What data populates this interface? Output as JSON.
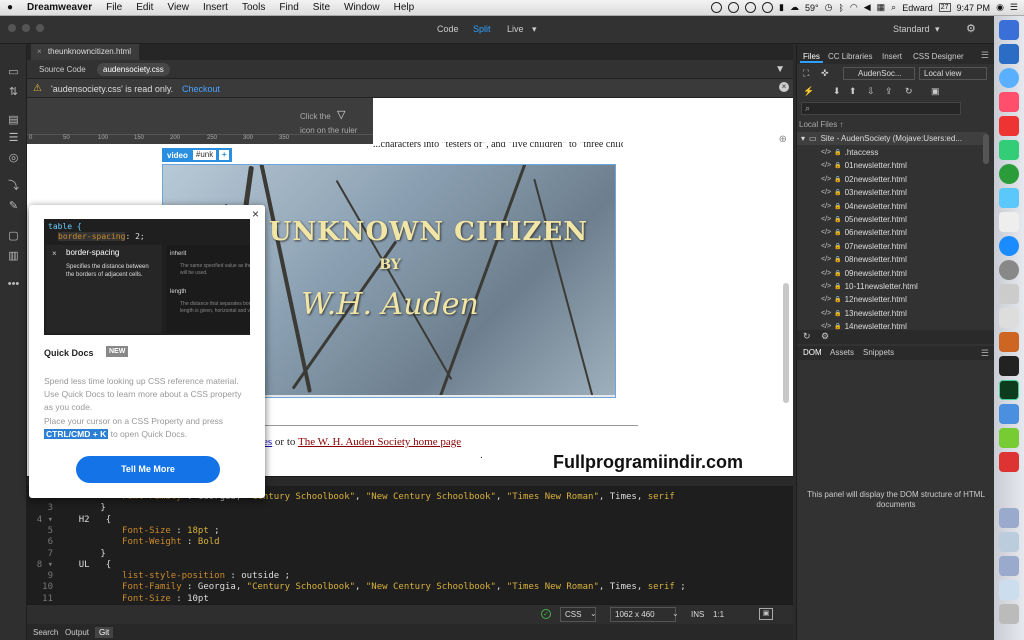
{
  "menubar": {
    "apple": "",
    "app": "Dreamweaver",
    "items": [
      "File",
      "Edit",
      "View",
      "Insert",
      "Tools",
      "Find",
      "Site",
      "Window",
      "Help"
    ],
    "temp": "59°",
    "user": "Edward",
    "date_badge": "27",
    "time": "9:47 PM"
  },
  "toolbar": {
    "modes": [
      "Code",
      "Split",
      "Live"
    ],
    "active_mode": "Split",
    "live_caret": "▾",
    "workspace": "Standard",
    "workspace_caret": "▾"
  },
  "doc": {
    "tab_title": "theunknowncitizen.html",
    "related_tabs": [
      "Source Code",
      "audensociety.css"
    ],
    "notice_prefix": "'audensociety.css' is read only.",
    "notice_link": "Checkout",
    "ruler_hint_line1": "Click the",
    "ruler_hint_line2": "icon on the ruler",
    "ruler_ticks": [
      "0",
      "50",
      "100",
      "150",
      "200",
      "250",
      "300",
      "350"
    ],
    "body_text_top": "...characters into \"testers of\", and \"live children\" to \"three children\".",
    "video_tag": "video",
    "video_id": "#unk",
    "video_plus": "+",
    "video_line1": "THE UNKNOWN CITIZEN",
    "video_line2": "BY",
    "video_line3": "W.H. Auden",
    "link_text_partial": "es",
    "link_or": "or to",
    "link_society": "The W. H. Auden Society home page",
    "dot": "."
  },
  "watermark": "Fullprogramiindir.com",
  "quickdocs": {
    "close": "×",
    "code_line1": "table {",
    "code_prop": "border-spacing",
    "code_val": ": 2;",
    "hint_title": "border-spacing",
    "hint_desc": "Specifies the distance between the borders of adjacent cells.",
    "hint_right_h1": "inherit",
    "hint_right_t1": "The same specified value as the element's parent will be used.",
    "hint_right_h2": "length",
    "hint_right_t2": "The distance that separates borders. If one length is given, horizontal and vertical",
    "title": "Quick Docs",
    "badge": "NEW",
    "para1": "Spend less time looking up CSS reference material. Use Quick Docs to learn more about a CSS property as you code.",
    "para2_a": "Place your cursor on a CSS Property and press",
    "kbd": "CTRL/CMD + K",
    "para2_b": "to open Quick Docs.",
    "button": "Tell Me More"
  },
  "code": {
    "lines": [
      {
        "n": "",
        "indent": "            ",
        "parts": [
          [
            "k",
            "Font-Family"
          ],
          [
            "t",
            " : Georgia, "
          ],
          [
            "s",
            "\"Century Schoolbook\""
          ],
          [
            "t",
            ", "
          ],
          [
            "s",
            "\"New Century Schoolbook\""
          ],
          [
            "t",
            ", "
          ],
          [
            "s",
            "\"Times New Roman\""
          ],
          [
            "t",
            ", Times, "
          ],
          [
            "s",
            "serif"
          ]
        ]
      },
      {
        "n": "3",
        "indent": "        ",
        "parts": [
          [
            "t",
            "}"
          ]
        ]
      },
      {
        "n": "4 ▾",
        "indent": "    ",
        "parts": [
          [
            "t",
            "H2   {"
          ]
        ]
      },
      {
        "n": "5",
        "indent": "            ",
        "parts": [
          [
            "k",
            "Font-Size"
          ],
          [
            "t",
            " : "
          ],
          [
            "s",
            "18pt"
          ],
          [
            "t",
            " ;"
          ]
        ]
      },
      {
        "n": "6",
        "indent": "            ",
        "parts": [
          [
            "k",
            "Font-Weight"
          ],
          [
            "t",
            " : "
          ],
          [
            "s",
            "Bold"
          ]
        ]
      },
      {
        "n": "7",
        "indent": "        ",
        "parts": [
          [
            "t",
            "}"
          ]
        ]
      },
      {
        "n": "8 ▾",
        "indent": "    ",
        "parts": [
          [
            "t",
            "UL   {"
          ]
        ]
      },
      {
        "n": "9",
        "indent": "            ",
        "parts": [
          [
            "k",
            "list-style-position"
          ],
          [
            "t",
            " : outside ;"
          ]
        ]
      },
      {
        "n": "10",
        "indent": "            ",
        "parts": [
          [
            "k",
            "Font-Family"
          ],
          [
            "t",
            " : Georgia, "
          ],
          [
            "s",
            "\"Century Schoolbook\""
          ],
          [
            "t",
            ", "
          ],
          [
            "s",
            "\"New Century Schoolbook\""
          ],
          [
            "t",
            ", "
          ],
          [
            "s",
            "\"Times New Roman\""
          ],
          [
            "t",
            ", Times, "
          ],
          [
            "s",
            "serif"
          ],
          [
            "t",
            " ;"
          ]
        ]
      },
      {
        "n": "11",
        "indent": "            ",
        "parts": [
          [
            "k",
            "Font-Size"
          ],
          [
            "t",
            " : 10pt"
          ]
        ]
      }
    ]
  },
  "status": {
    "ok_icon": "✓",
    "lang": "CSS",
    "dims": "1062 x 460",
    "ins": "INS",
    "pos": "1:1"
  },
  "bottom_tabs": [
    "Search",
    "Output",
    "Git"
  ],
  "active_bottom_tab": "Git",
  "files_panel": {
    "tabs": [
      "Files",
      "CC Libraries",
      "Insert",
      "CSS Designer"
    ],
    "site_select": "AudenSoc...",
    "view_select": "Local view",
    "local_files": "Local Files ↑",
    "site_root": "Site - AudenSociety (Mojave:Users:ed...",
    "files": [
      ".htaccess",
      "01newsletter.html",
      "02newsletter.html",
      "03newsletter.html",
      "04newsletter.html",
      "05newsletter.html",
      "06newsletter.html",
      "07newsletter.html",
      "08newsletter.html",
      "09newsletter.html",
      "10-11newsletter.html",
      "12newsletter.html",
      "13newsletter.html",
      "14newsletter.html"
    ]
  },
  "dom_panel": {
    "tabs": [
      "DOM",
      "Assets",
      "Snippets"
    ],
    "message": "This panel will display the DOM structure of HTML documents"
  }
}
